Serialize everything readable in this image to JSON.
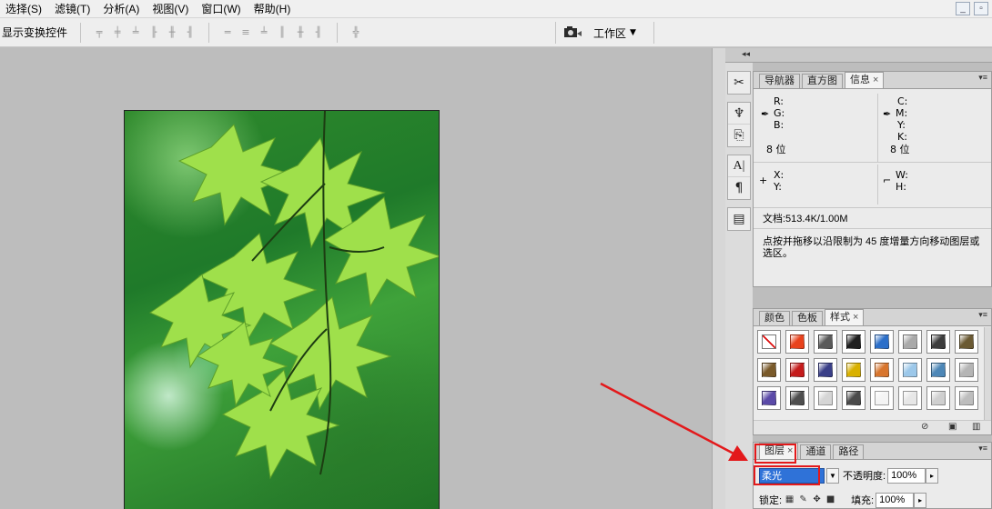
{
  "menubar": {
    "items": [
      "选择(S)",
      "滤镜(T)",
      "分析(A)",
      "视图(V)",
      "窗口(W)",
      "帮助(H)"
    ]
  },
  "options": {
    "show_transform_controls": "显示变换控件",
    "workspace_label": "工作区"
  },
  "info_panel": {
    "tabs": [
      "导航器",
      "直方图",
      "信息"
    ],
    "close_symbol": "×",
    "rgb_labels": [
      "R:",
      "G:",
      "B:"
    ],
    "cmyk_labels": [
      "C:",
      "M:",
      "Y:",
      "K:"
    ],
    "bit_left": "8 位",
    "bit_right": "8 位",
    "x_label": "X:",
    "y_label": "Y:",
    "w_label": "W:",
    "h_label": "H:",
    "doc_info": "文档:513.4K/1.00M",
    "hint": "点按并拖移以沿限制为 45 度增量方向移动图层或选区。"
  },
  "styles_panel": {
    "tabs": [
      "颜色",
      "色板",
      "样式"
    ],
    "close_symbol": "×",
    "swatches": [
      {
        "name": "none",
        "color": "#ffffff"
      },
      {
        "name": "sun",
        "color": "#e9421c"
      },
      {
        "name": "dark-gray",
        "color": "#5a5a5a"
      },
      {
        "name": "black-chrome",
        "color": "#1f1f1f"
      },
      {
        "name": "blue-glass",
        "color": "#2c6fc9"
      },
      {
        "name": "light-gray",
        "color": "#a9a9a9"
      },
      {
        "name": "smoke",
        "color": "#3d3d3d"
      },
      {
        "name": "bronze",
        "color": "#6b5a33"
      },
      {
        "name": "brown",
        "color": "#7a5a2a"
      },
      {
        "name": "red",
        "color": "#c51c1c"
      },
      {
        "name": "multicolor",
        "color": "#3a3f88"
      },
      {
        "name": "gold",
        "color": "#d9b100"
      },
      {
        "name": "orange-gradient",
        "color": "#d8752d"
      },
      {
        "name": "sky",
        "color": "#9cc8ea"
      },
      {
        "name": "sunset",
        "color": "#4d87b7"
      },
      {
        "name": "silver-frame",
        "color": "#b5b5b5"
      },
      {
        "name": "purple-cube",
        "color": "#5b4aa8"
      },
      {
        "name": "charcoal",
        "color": "#4e4e4e"
      },
      {
        "name": "outline-gray",
        "color": "#d5d5d5"
      },
      {
        "name": "dark-bevel",
        "color": "#4a4a4a"
      },
      {
        "name": "white-outline",
        "color": "#f4f4f4"
      },
      {
        "name": "pale",
        "color": "#e7e7e7"
      },
      {
        "name": "bevel-gray",
        "color": "#cfcfcf"
      },
      {
        "name": "glass-gray",
        "color": "#bdbdbd"
      }
    ]
  },
  "layers_panel": {
    "tabs": [
      "图层",
      "通道",
      "路径"
    ],
    "close_symbol": "×",
    "blend_mode": "柔光",
    "opacity_label": "不透明度:",
    "opacity_value": "100%",
    "lock_label": "锁定:",
    "fill_label": "填充:",
    "fill_value": "100%"
  },
  "colors": {
    "annotation_red": "#e3191b",
    "selection_blue": "#2f72d8"
  }
}
